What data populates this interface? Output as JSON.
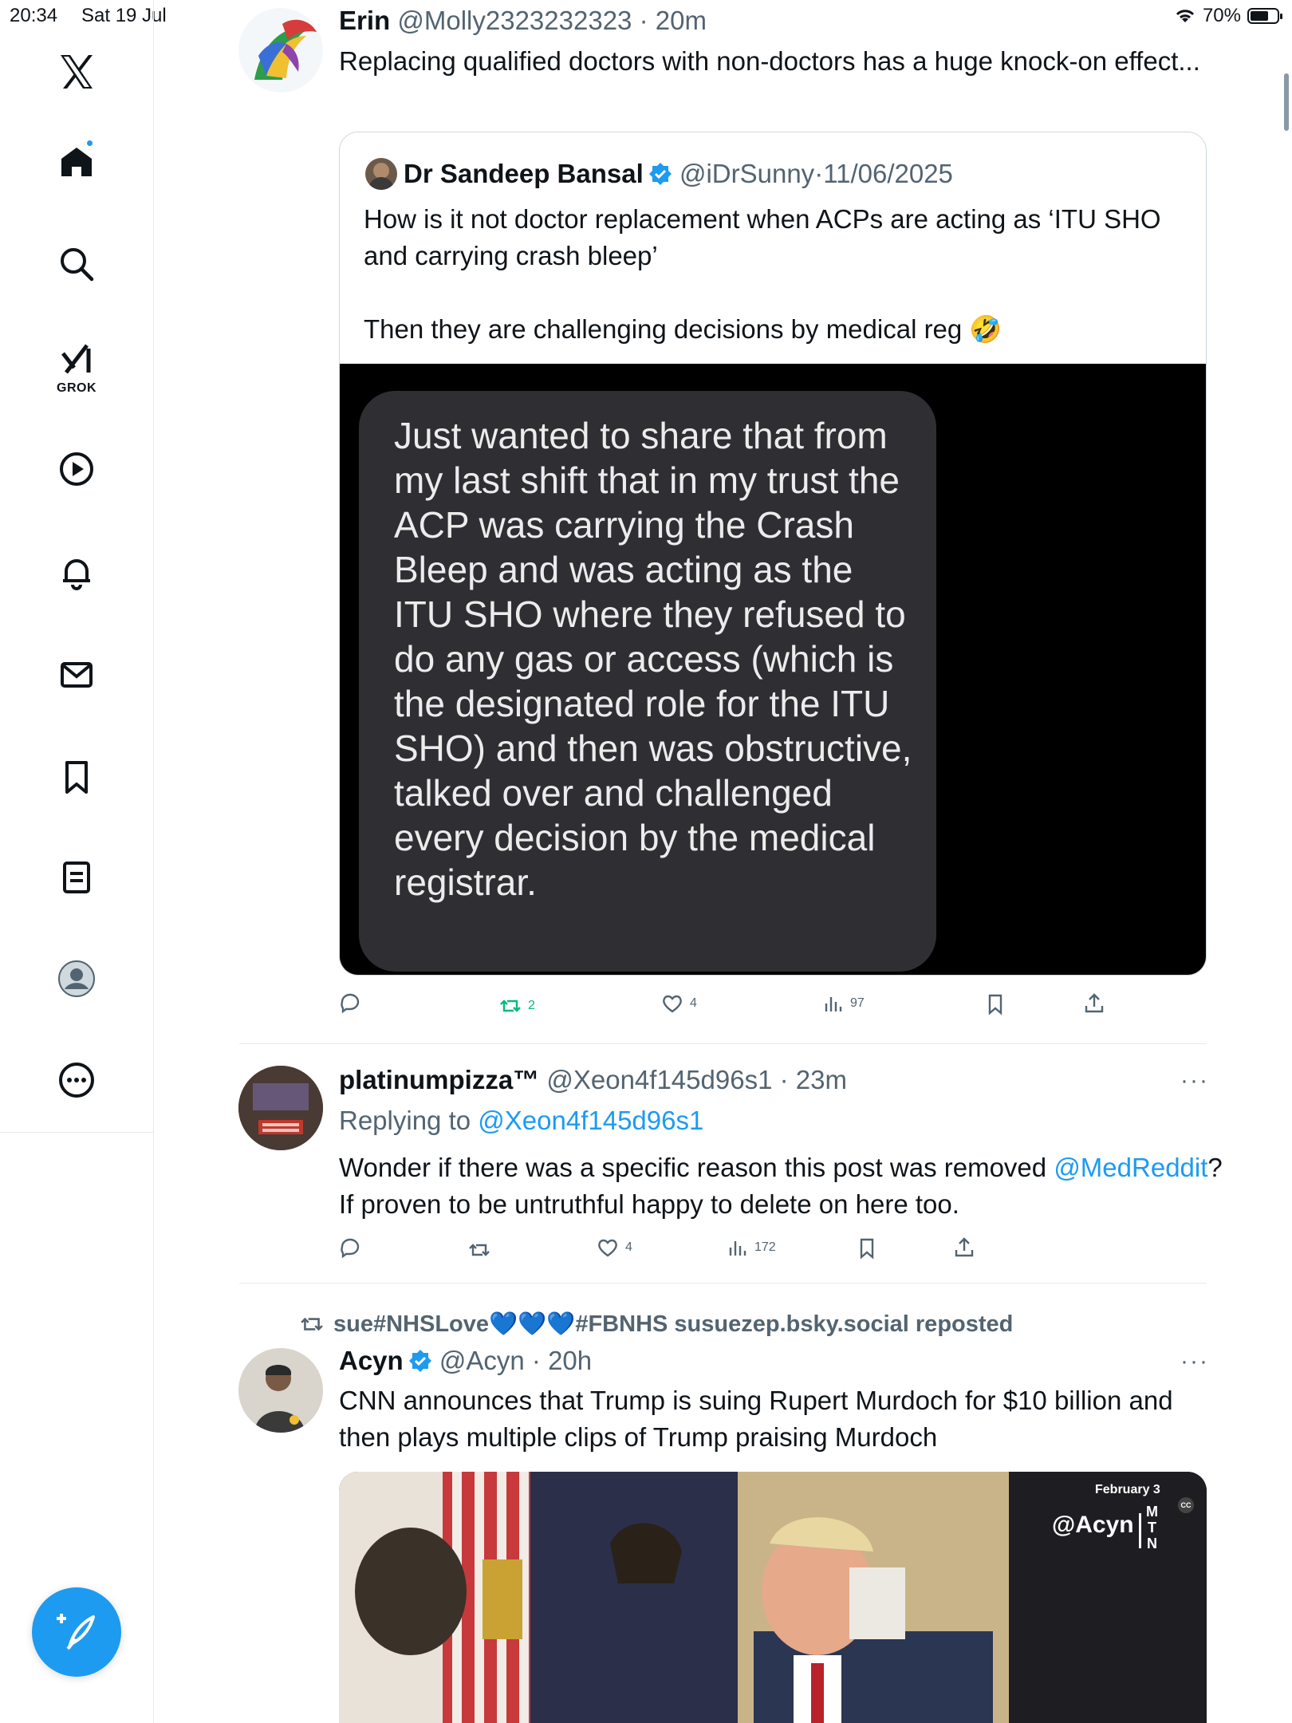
{
  "status_bar": {
    "time": "20:34",
    "date": "Sat 19 Jul",
    "battery": "70%",
    "battery_level": 0.7
  },
  "sidebar": {
    "grok_label": "GROK",
    "items": [
      "x-logo",
      "home-icon",
      "search-icon",
      "grok-icon",
      "video-icon",
      "notifications-icon",
      "messages-icon",
      "bookmarks-icon",
      "lists-icon",
      "profile-icon",
      "more-icon"
    ],
    "compose_icon": "compose-icon"
  },
  "tweets": [
    {
      "name": "Erin",
      "handle": "@Molly2323232323",
      "time": "20m",
      "text": "Replacing qualified doctors with non-doctors has a huge knock-on effect...",
      "quote": {
        "name": "Dr Sandeep Bansal",
        "handle": "@iDrSunny",
        "date": "11/06/2025",
        "text_line1": "How is it not doctor replacement when ACPs are acting as ‘ITU SHO and carrying crash bleep’",
        "text_line2": "Then they are challenging decisions by medical reg 🤣",
        "image_text": "Just wanted to share that from my  last shift that in my trust the ACP was carrying the Crash Bleep and was acting as the ITU SHO where they refused to do any gas or access (which is the designated role for the ITU SHO) and then was obstructive,  talked over and challenged every decision by the medical registrar."
      },
      "actions": {
        "reposts": "2",
        "likes": "4",
        "views": "97"
      }
    },
    {
      "name": "platinumpizza™",
      "handle": "@Xeon4f145d96s1",
      "time": "23m",
      "replying_prefix": "Replying to ",
      "replying_to": "@Xeon4f145d96s1",
      "text_before": "Wonder if there was a specific reason this post was removed ",
      "mention": "@MedReddit",
      "text_after": "? If proven to be untruthful happy to delete on here too.",
      "more": "···",
      "actions": {
        "likes": "4",
        "views": "172"
      }
    },
    {
      "repost_label": "sue#NHSLove💙💙💙#FBNHS susuezep.bsky.social reposted",
      "name": "Acyn",
      "handle": "@Acyn",
      "time": "20h",
      "more": "···",
      "text": "CNN announces that Trump is suing Rupert Murdoch for $10 billion and then plays multiple clips of Trump praising Murdoch",
      "video_overlay": {
        "date": "February 3",
        "watermark": "@Acyn",
        "mtn": [
          "M",
          "T",
          "N"
        ],
        "cc": "CC"
      }
    }
  ]
}
